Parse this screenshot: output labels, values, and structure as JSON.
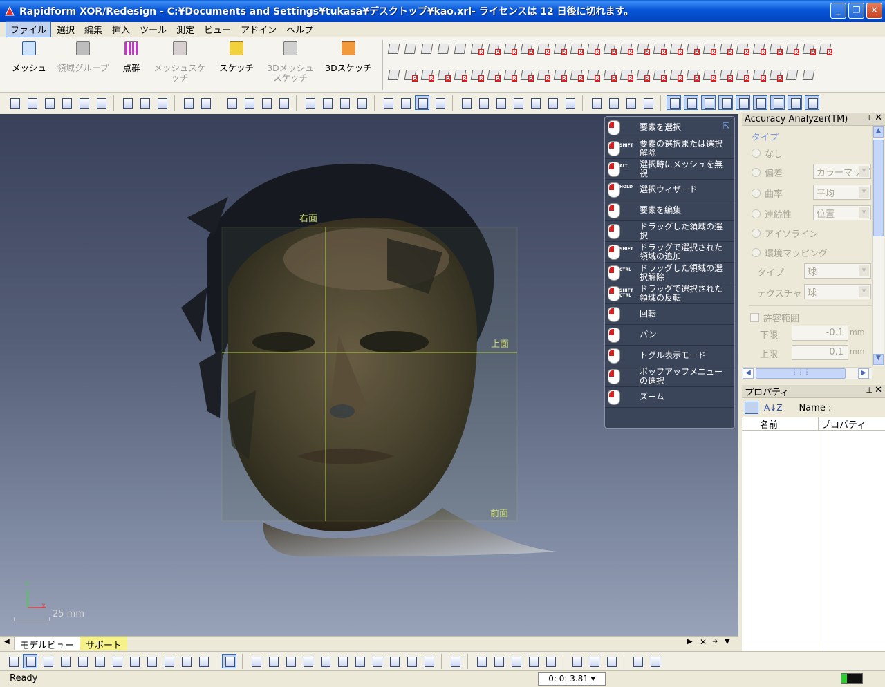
{
  "window": {
    "title": "Rapidform XOR/Redesign - C:¥Documents and Settings¥tukasa¥デスクトップ¥kao.xrl- ライセンスは 12 日後に切れます。",
    "minimize": "_",
    "maximize": "❐",
    "close": "✕"
  },
  "menu": [
    "ファイル",
    "選択",
    "編集",
    "挿入",
    "ツール",
    "測定",
    "ビュー",
    "アドイン",
    "ヘルプ"
  ],
  "ribbon": {
    "mesh": "メッシュ",
    "region_group": "領域グループ",
    "point_cloud": "点群",
    "mesh_sketch": "メッシュスケッチ",
    "sketch": "スケッチ",
    "mesh3d_sketch": "3Dメッシュスケッチ",
    "sketch3d": "3Dスケッチ"
  },
  "viewport": {
    "plane_right": "右面",
    "plane_top": "上面",
    "plane_front": "前面",
    "axis_x": "X",
    "axis_y": "Y",
    "scale": "25 mm"
  },
  "mouse_help": [
    {
      "label": "要素を選択",
      "tag": ""
    },
    {
      "label": "要素の選択または選択解除",
      "tag": "SHIFT"
    },
    {
      "label": "選択時にメッシュを無視",
      "tag": "ALT"
    },
    {
      "label": "選択ウィザード",
      "tag": "HOLD"
    },
    {
      "label": "要素を編集",
      "tag": ""
    },
    {
      "label": "ドラッグした領域の選択",
      "tag": ""
    },
    {
      "label": "ドラッグで選択された領域の追加",
      "tag": "SHIFT"
    },
    {
      "label": "ドラッグした領域の選択解除",
      "tag": "CTRL"
    },
    {
      "label": "ドラッグで選択された領域の反転",
      "tag": "SHIFT CTRL"
    },
    {
      "label": "回転",
      "tag": ""
    },
    {
      "label": "パン",
      "tag": ""
    },
    {
      "label": "トグル表示モード",
      "tag": ""
    },
    {
      "label": "ポップアップメニューの選択",
      "tag": ""
    },
    {
      "label": "ズーム",
      "tag": ""
    }
  ],
  "accuracy": {
    "title": "Accuracy Analyzer(TM)",
    "type_group": "タイプ",
    "none": "なし",
    "deviation": "偏差",
    "deviation_value": "カラーマップ",
    "curvature": "曲率",
    "curvature_value": "平均",
    "continuity": "連続性",
    "continuity_value": "位置",
    "isoline": "アイソライン",
    "env_mapping": "環境マッピング",
    "type_label": "タイプ",
    "type_value": "球",
    "texture_label": "テクスチャ",
    "texture_value": "球",
    "tolerance": "許容範囲",
    "lower_label": "下限",
    "lower_value": "-0.1",
    "upper_label": "上限",
    "upper_value": "0.1",
    "unit": "mm"
  },
  "properties": {
    "title": "プロパティ",
    "name_label": "Name :",
    "col_name": "名前",
    "col_property": "プロパティ"
  },
  "tabs": {
    "model_view": "モデルビュー",
    "support": "サポート"
  },
  "status": {
    "text": "Ready",
    "time": "0: 0: 3.81"
  }
}
